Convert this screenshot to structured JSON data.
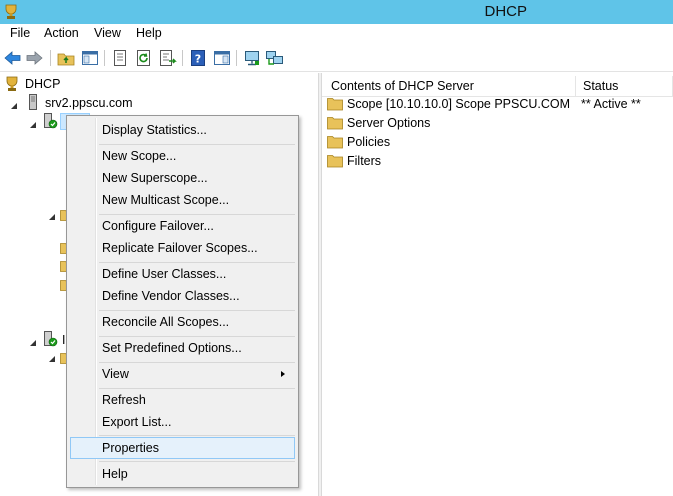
{
  "window": {
    "title": "DHCP"
  },
  "menubar": {
    "items": [
      "File",
      "Action",
      "View",
      "Help"
    ]
  },
  "toolbar": {
    "buttons": [
      "back-icon",
      "forward-icon",
      "up-folder-icon",
      "show-hide-tree-icon",
      "properties-icon",
      "refresh-icon",
      "export-list-icon",
      "help-icon",
      "show-hide-action-pane-icon",
      "monitor-icon",
      "network-icon"
    ]
  },
  "tree": {
    "root_label": "DHCP",
    "server_label": "srv2.ppscu.com",
    "partial_label": "I"
  },
  "list": {
    "headers": [
      "Contents of DHCP Server",
      "Status"
    ],
    "rows": [
      {
        "name": "Scope [10.10.10.0] Scope PPSCU.COM",
        "status": "** Active **"
      },
      {
        "name": "Server Options",
        "status": ""
      },
      {
        "name": "Policies",
        "status": ""
      },
      {
        "name": "Filters",
        "status": ""
      }
    ]
  },
  "context_menu": {
    "items": [
      "Display Statistics...",
      "New Scope...",
      "New Superscope...",
      "New Multicast Scope...",
      "Configure Failover...",
      "Replicate Failover Scopes...",
      "Define User Classes...",
      "Define Vendor Classes...",
      "Reconcile All Scopes...",
      "Set Predefined Options...",
      "View",
      "Refresh",
      "Export List...",
      "Properties",
      "Help"
    ],
    "highlighted": "Properties"
  },
  "colors": {
    "titlebar": "#5fc4e8",
    "menu_background": "#f0f0f0",
    "highlight_fill": "#e5f1fb",
    "highlight_border": "#90c8f6",
    "folder": "#e8c25a"
  }
}
